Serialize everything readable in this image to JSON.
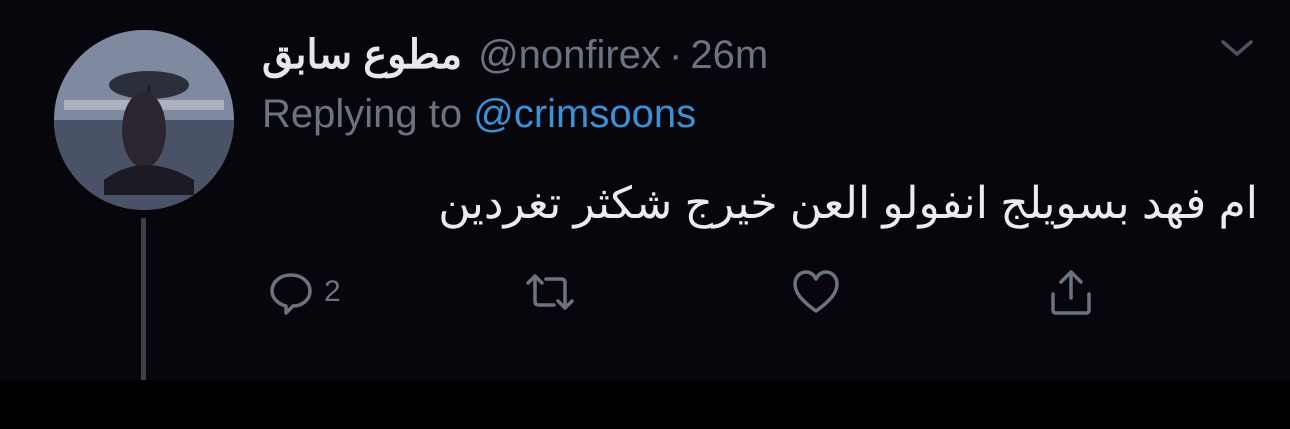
{
  "tweet": {
    "display_name": "مطوع سابق",
    "handle": "@nonfirex",
    "separator": "·",
    "time": "26m",
    "replying_prefix": "Replying to ",
    "replying_to": "@crimsoons",
    "text": "ام فهد بسويلج انفولو العن خيرج شكثر تغردين"
  },
  "actions": {
    "reply_icon": "reply-icon",
    "reply_count": "2",
    "retweet_icon": "retweet-icon",
    "like_icon": "heart-icon",
    "share_icon": "share-icon"
  },
  "colors": {
    "background": "#06060c",
    "primary_text": "#ececee",
    "secondary_text": "#6c7380",
    "link": "#3d8fd6"
  }
}
